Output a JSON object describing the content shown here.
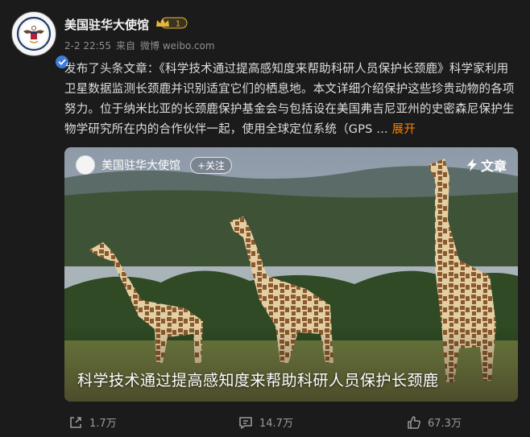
{
  "author": {
    "name": "美国驻华大使馆",
    "badge_level": "1"
  },
  "meta": {
    "date": "2-2 22:55",
    "source_prefix": "来自",
    "source": "微博 weibo.com"
  },
  "post": {
    "text": "发布了头条文章：《科学技术通过提高感知度来帮助科研人员保护长颈鹿》科学家利用卫星数据监测长颈鹿并识别适宜它们的栖息地。本文详细介绍保护这些珍贵动物的各项努力。位于纳米比亚的长颈鹿保护基金会与包括设在美国弗吉尼亚州的史密森尼保护生物学研究所在内的合作伙伴一起，使用全球定位系统（GPS",
    "ellipsis": " ... ",
    "expand": "展开"
  },
  "card": {
    "author_name": "美国驻华大使馆",
    "follow_label": "+关注",
    "article_label": "文章",
    "title": "科学技术通过提高感知度来帮助科研人员保护长颈鹿"
  },
  "actions": {
    "share_count": "1.7万",
    "comment_count": "14.7万",
    "like_count": "67.3万"
  },
  "colors": {
    "background": "#1b1b1b",
    "link_accent": "#ff8200",
    "verified_blue": "#3d7bd9",
    "badge_gold": "#e8b53a"
  },
  "icons": [
    "verified-icon",
    "crown-badge-icon",
    "lightning-icon",
    "share-icon",
    "comment-icon",
    "like-icon"
  ]
}
